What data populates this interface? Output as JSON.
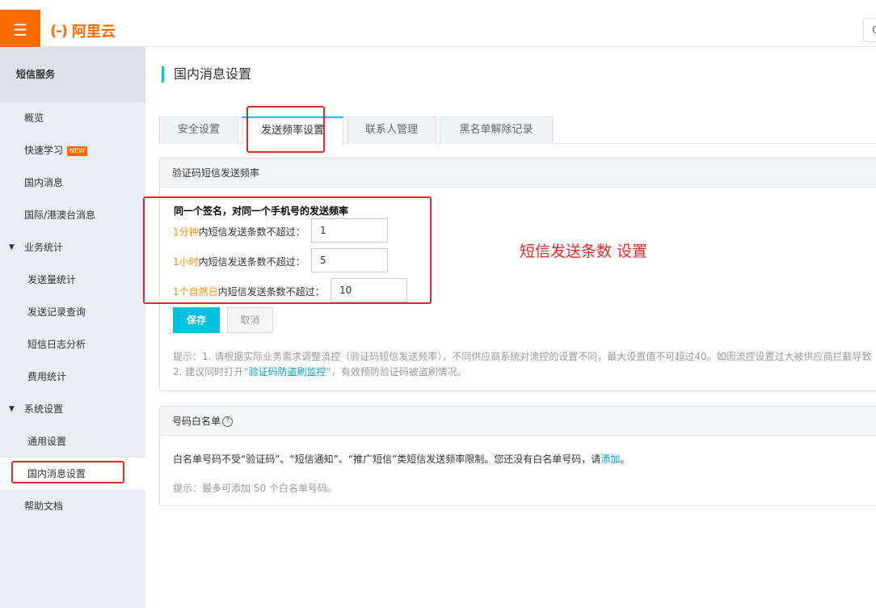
{
  "header": {
    "menu_icon": "☰",
    "logo_mark": "(-)",
    "logo_text": "阿里云",
    "search_icon": "Q"
  },
  "sidebar": {
    "title": "短信服务",
    "items": [
      {
        "label": "概览"
      },
      {
        "label": "快速学习",
        "badge": "NEW"
      },
      {
        "label": "国内消息"
      },
      {
        "label": "国际/港澳台消息"
      },
      {
        "label": "业务统计",
        "caret": "▼"
      },
      {
        "label": "发送量统计"
      },
      {
        "label": "发送记录查询"
      },
      {
        "label": "短信日志分析"
      },
      {
        "label": "费用统计"
      },
      {
        "label": "系统设置",
        "caret": "▼"
      },
      {
        "label": "通用设置"
      },
      {
        "label": "国内消息设置"
      },
      {
        "label": "帮助文档"
      }
    ]
  },
  "page": {
    "title": "国内消息设置"
  },
  "tabs": [
    {
      "label": "安全设置"
    },
    {
      "label": "发送频率设置"
    },
    {
      "label": "联系人管理"
    },
    {
      "label": "黑名单解除记录"
    }
  ],
  "frequency": {
    "panel_title": "验证码短信发送频率",
    "rule_title": "同一个签名，对同一个手机号的发送频率",
    "rows": [
      {
        "highlight": "1分钟",
        "label": "内短信发送条数不超过：",
        "value": "1"
      },
      {
        "highlight": "1小时",
        "label": "内短信发送条数不超过：",
        "value": "5"
      },
      {
        "highlight": "1个自然日",
        "label": "内短信发送条数不超过：",
        "value": "10"
      }
    ],
    "save_label": "保存",
    "cancel_label": "取消",
    "tip1": "提示：1. 请根据实际业务需求调整流控（验证码短信发送频率），不同供应商系统对流控的设置不同，最大设置值不可超过40。如因流控设置过大被供应商拦截导致",
    "tip2_prefix": "2. 建议同时打开“",
    "tip2_link": "验证码防盗刷监控",
    "tip2_suffix": "”，有效预防验证码被盗刷情况。"
  },
  "whitelist": {
    "panel_title": "号码白名单",
    "help_icon": "?",
    "desc": "白名单号码不受“验证码”、“短信通知”、“推广短信”类短信发送频率限制。您还没有白名单号码，请",
    "add_link": "添加",
    "desc_end": "。",
    "tip": "提示：最多可添加 50 个白名单号码。"
  },
  "annotation": {
    "text": "短信发送条数 设置",
    "color": "#e5262b"
  },
  "colors": {
    "accent": "#00c1de",
    "brand": "#ff6a00",
    "highlight": "#ff8a00",
    "link": "#00a2ca"
  }
}
